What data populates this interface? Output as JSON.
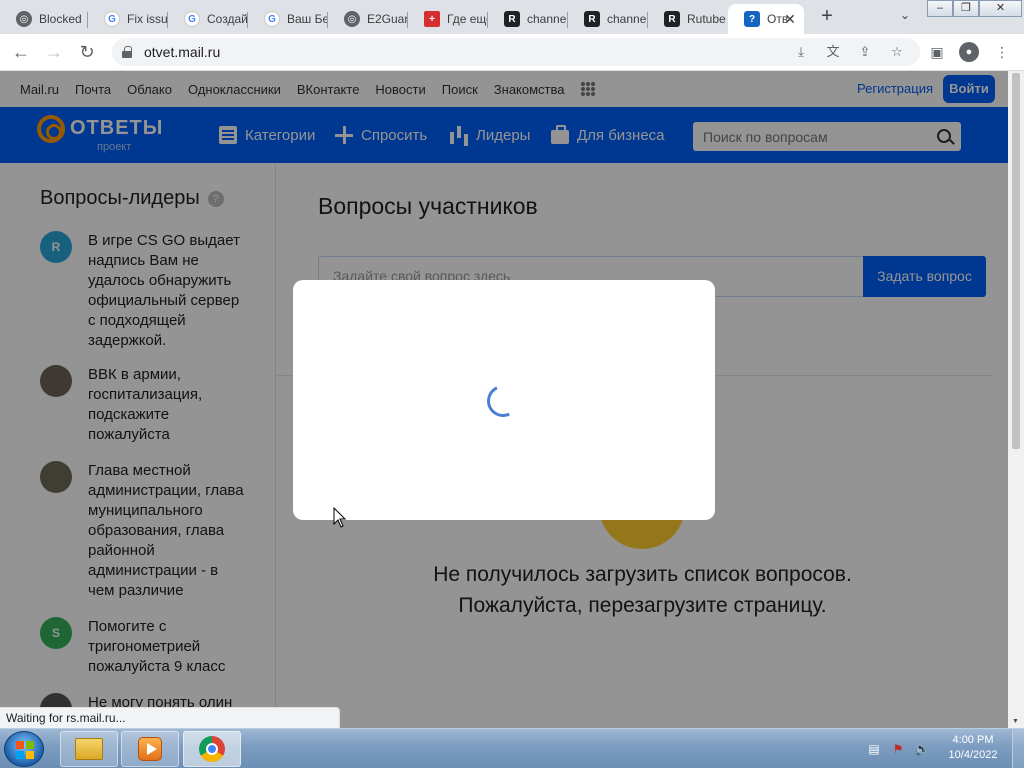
{
  "browser": {
    "tabs": [
      {
        "label": "Blocked",
        "icon": "globe-icon"
      },
      {
        "label": "Fix issu",
        "icon": "google-icon"
      },
      {
        "label": "Создай",
        "icon": "google-icon"
      },
      {
        "label": "Ваш Бе",
        "icon": "google-icon"
      },
      {
        "label": "E2Guar",
        "icon": "globe-icon"
      },
      {
        "label": "Где еще",
        "icon": "flag-icon"
      },
      {
        "label": "channe",
        "icon": "rutube-icon"
      },
      {
        "label": "channe",
        "icon": "rutube-icon"
      },
      {
        "label": "Rutube",
        "icon": "rutube-icon"
      },
      {
        "label": "Отв",
        "icon": "otvety-icon",
        "active": true
      }
    ],
    "url": "otvet.mail.ru",
    "status": "Waiting for rs.mail.ru..."
  },
  "portal": {
    "links": [
      "Mail.ru",
      "Почта",
      "Облако",
      "Одноклассники",
      "ВКонтакте",
      "Новости",
      "Поиск",
      "Знакомства"
    ],
    "register": "Регистрация",
    "login": "Войти"
  },
  "header": {
    "logo_text": "ОТВЕТЫ",
    "logo_sub": "проект",
    "nav": [
      {
        "label": "Категории",
        "icon": "list-icon"
      },
      {
        "label": "Спросить",
        "icon": "plus-icon"
      },
      {
        "label": "Лидеры",
        "icon": "bar-chart-icon"
      },
      {
        "label": "Для бизнеса",
        "icon": "briefcase-icon"
      }
    ],
    "search_placeholder": "Поиск по вопросам"
  },
  "sidebar": {
    "title": "Вопросы-лидеры",
    "items": [
      {
        "avatar": "R",
        "avatar_color": "#29a5d9",
        "text": "В игре CS GO выдает надпись Вам не удалось обнаружить официальный сервер с подходящей задержкой."
      },
      {
        "avatar": "",
        "avatar_color": "#6b6558",
        "text": "ВВК в армии, госпитализация, подскажите пожалуйста"
      },
      {
        "avatar": "",
        "avatar_color": "#6f6a56",
        "text": "Глава местной администрации, глава муниципального образования, глава районной администрации - в чем различие"
      },
      {
        "avatar": "S",
        "avatar_color": "#34b15a",
        "text": "Помогите с тригонометрией пожалуйста 9 класс"
      },
      {
        "avatar": "",
        "avatar_color": "#555555",
        "text": "Не могу понять олин"
      }
    ]
  },
  "main": {
    "title": "Вопросы участников",
    "ask_placeholder": "Задайте свой вопрос здесь",
    "ask_button": "Задать вопрос",
    "error_line1": "Не получилось загрузить список вопросов.",
    "error_line2": "Пожалуйста, перезагрузите страницу."
  },
  "taskbar": {
    "time": "4:00 PM",
    "date": "10/4/2022"
  },
  "colors": {
    "brand_blue": "#005ff9",
    "logo_orange": "#ff9e00"
  }
}
